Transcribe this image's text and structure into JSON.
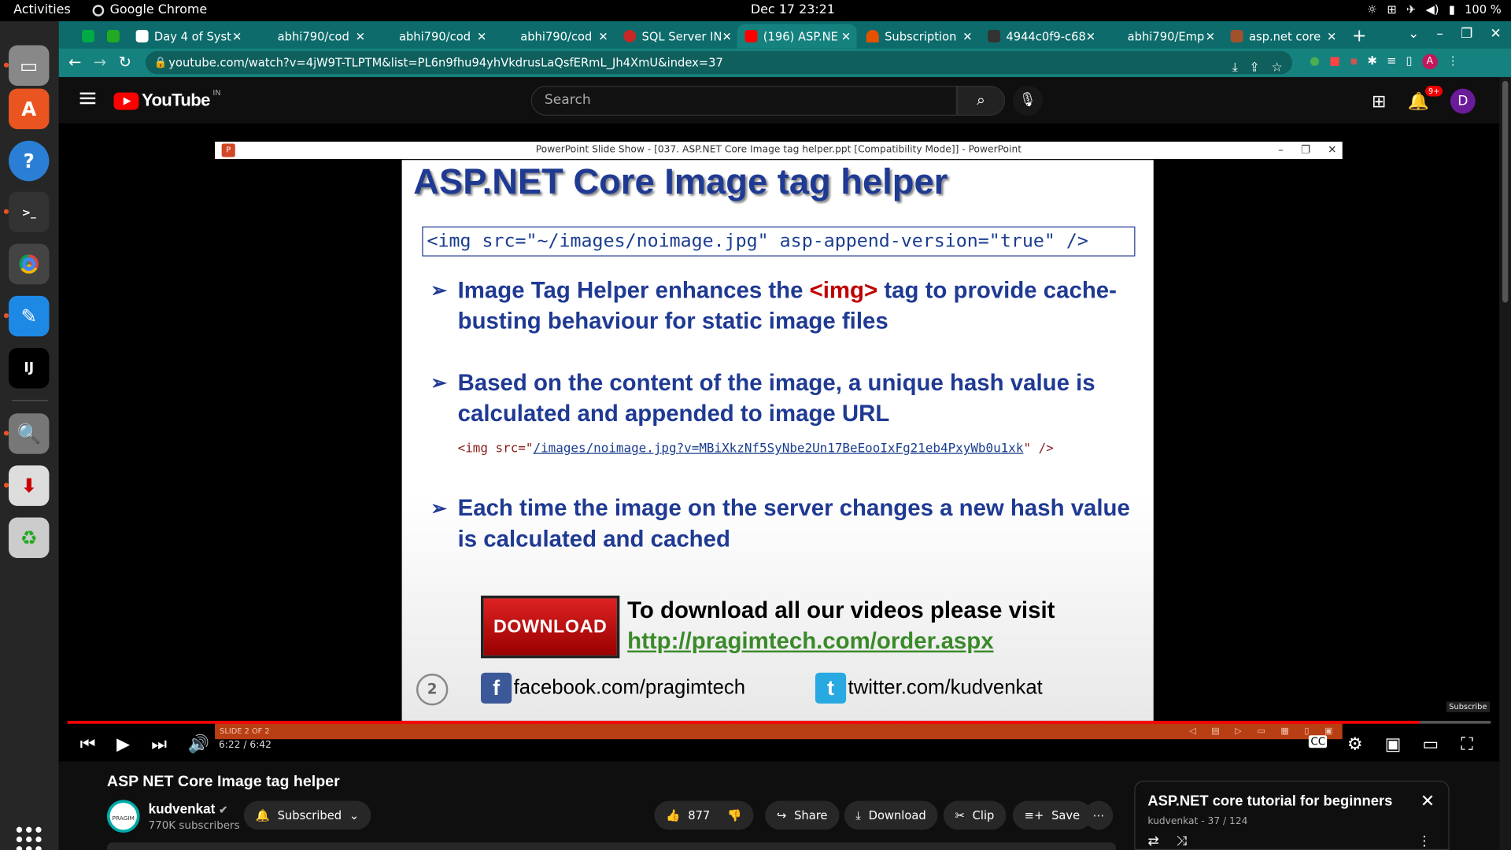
{
  "system": {
    "activities": "Activities",
    "app_name": "Google Chrome",
    "clock": "Dec 17  23:21",
    "battery": "100 %"
  },
  "browser": {
    "tabs": [
      {
        "label": "Day 4 of Syst"
      },
      {
        "label": "abhi790/cod"
      },
      {
        "label": "abhi790/cod"
      },
      {
        "label": "abhi790/cod"
      },
      {
        "label": "SQL Server IN"
      },
      {
        "label": "(196) ASP.NE"
      },
      {
        "label": "Subscription"
      },
      {
        "label": "4944c0f9-c68"
      },
      {
        "label": "abhi790/Emp"
      },
      {
        "label": "asp.net core"
      }
    ],
    "url": "youtube.com/watch?v=4jW9T-TLPTM&list=PL6n9fhu94yhVkdrusLaQsfERmL_Jh4XmU&index=37"
  },
  "youtube": {
    "logo_text": "YouTube",
    "country": "IN",
    "search_placeholder": "Search",
    "notif_badge": "9+",
    "avatar_letter": "D"
  },
  "ppt": {
    "window_title": "PowerPoint Slide Show - [037. ASP.NET Core Image tag helper.ppt [Compatibility Mode]] - PowerPoint",
    "slide_title": "ASP.NET Core Image tag helper",
    "code_box": "<img src=\"~/images/noimage.jpg\" asp-append-version=\"true\" />",
    "bullet1_pre": "Image Tag Helper enhances the ",
    "bullet1_tag": "<img>",
    "bullet1_post": " tag to provide cache-busting behaviour for static image files",
    "bullet2": "Based on the content of the image, a unique hash value is calculated and appended to image URL",
    "code_line_pre": "<img src=\"",
    "code_line_link": "/images/noimage.jpg?v=MBiXkzNf5SyNbe2Un17BeEooIxFg21eb4PxyWb0u1xk",
    "code_line_post": "\" />",
    "bullet3": "Each time the image on the server changes a new hash value is calculated and cached",
    "download_btn": "DOWNLOAD",
    "download_text": "To download all our videos please visit",
    "download_link": "http://pragimtech.com/order.aspx",
    "slide_number": "2",
    "facebook": "facebook.com/pragimtech",
    "twitter": "twitter.com/kudvenkat",
    "status": "SLIDE 2 OF 2"
  },
  "player": {
    "time": "6:22 / 6:42",
    "progress": 0.95,
    "watermark": "Subscribe"
  },
  "video": {
    "title": "ASP NET Core Image tag helper",
    "channel": "kudvenkat",
    "subscribers": "770K subscribers",
    "subscribed_label": "Subscribed",
    "likes": "877",
    "share": "Share",
    "download": "Download",
    "clip": "Clip",
    "save": "Save"
  },
  "playlist": {
    "title": "ASP.NET core tutorial for beginners",
    "subtitle": "kudvenkat - 37 / 124"
  }
}
